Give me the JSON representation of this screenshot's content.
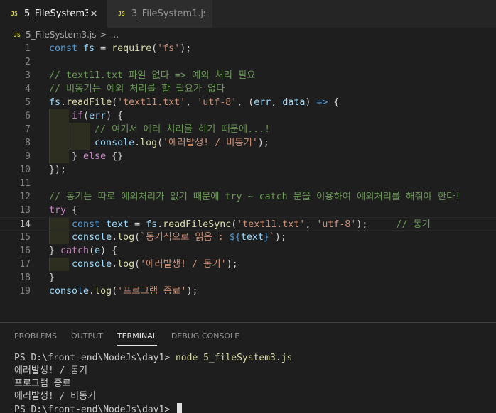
{
  "tabs": [
    {
      "icon": "JS",
      "label": "5_FileSystem3.js",
      "active": true,
      "close": "✕"
    },
    {
      "icon": "JS",
      "label": "3_FileSystem1.js",
      "active": false
    }
  ],
  "breadcrumb": {
    "icon": "JS",
    "file": "5_FileSystem3.js",
    "sep": ">",
    "rest": "..."
  },
  "editor": {
    "current_line": 14,
    "lines": [
      {
        "n": "1",
        "tokens": [
          [
            "k",
            "const "
          ],
          [
            "v",
            "fs "
          ],
          [
            "p",
            "= "
          ],
          [
            "f",
            "require"
          ],
          [
            "p",
            "("
          ],
          [
            "s",
            "'fs'"
          ],
          [
            "p",
            ");"
          ]
        ]
      },
      {
        "n": "2",
        "tokens": []
      },
      {
        "n": "3",
        "tokens": [
          [
            "c",
            "// text11.txt 파일 없다 => 예외 처리 필요"
          ]
        ]
      },
      {
        "n": "4",
        "tokens": [
          [
            "c",
            "// 비동기는 예외 처리를 할 필요가 없다"
          ]
        ]
      },
      {
        "n": "5",
        "tokens": [
          [
            "v",
            "fs"
          ],
          [
            "p",
            "."
          ],
          [
            "f",
            "readFile"
          ],
          [
            "p",
            "("
          ],
          [
            "s",
            "'text11.txt'"
          ],
          [
            "p",
            ", "
          ],
          [
            "s",
            "'utf-8'"
          ],
          [
            "p",
            ", ("
          ],
          [
            "v",
            "err"
          ],
          [
            "p",
            ", "
          ],
          [
            "v",
            "data"
          ],
          [
            "p",
            ") "
          ],
          [
            "k",
            "=>"
          ],
          [
            "p",
            " {"
          ]
        ]
      },
      {
        "n": "6",
        "tokens": [
          [
            "p",
            "    "
          ],
          [
            "cf",
            "if"
          ],
          [
            "p",
            "("
          ],
          [
            "v",
            "err"
          ],
          [
            "p",
            ") {"
          ]
        ]
      },
      {
        "n": "7",
        "tokens": [
          [
            "p",
            "        "
          ],
          [
            "c",
            "// 여기서 에러 처리를 하기 때문에...!"
          ]
        ]
      },
      {
        "n": "8",
        "tokens": [
          [
            "p",
            "        "
          ],
          [
            "v",
            "console"
          ],
          [
            "p",
            "."
          ],
          [
            "f",
            "log"
          ],
          [
            "p",
            "("
          ],
          [
            "s",
            "'에러발생! / 비동기'"
          ],
          [
            "p",
            ");"
          ]
        ]
      },
      {
        "n": "9",
        "tokens": [
          [
            "p",
            "    } "
          ],
          [
            "cf",
            "else"
          ],
          [
            "p",
            " {}"
          ]
        ]
      },
      {
        "n": "10",
        "tokens": [
          [
            "p",
            "});"
          ]
        ]
      },
      {
        "n": "11",
        "tokens": []
      },
      {
        "n": "12",
        "tokens": [
          [
            "c",
            "// 동기는 따로 예외처리가 없기 때문에 try ~ catch 문을 이용하여 예외처리를 해줘야 한다!"
          ]
        ]
      },
      {
        "n": "13",
        "tokens": [
          [
            "cf",
            "try"
          ],
          [
            "p",
            " {"
          ]
        ]
      },
      {
        "n": "14",
        "tokens": [
          [
            "p",
            "    "
          ],
          [
            "k",
            "const "
          ],
          [
            "v",
            "text "
          ],
          [
            "p",
            "= "
          ],
          [
            "v",
            "fs"
          ],
          [
            "p",
            "."
          ],
          [
            "f",
            "readFileSync"
          ],
          [
            "p",
            "("
          ],
          [
            "s",
            "'text11.txt'"
          ],
          [
            "p",
            ", "
          ],
          [
            "s",
            "'utf-8'"
          ],
          [
            "p",
            ");     "
          ],
          [
            "c",
            "// 동기"
          ]
        ]
      },
      {
        "n": "15",
        "tokens": [
          [
            "p",
            "    "
          ],
          [
            "v",
            "console"
          ],
          [
            "p",
            "."
          ],
          [
            "f",
            "log"
          ],
          [
            "p",
            "("
          ],
          [
            "s",
            "`동기식으로 읽음 : "
          ],
          [
            "tpl",
            "${"
          ],
          [
            "v",
            "text"
          ],
          [
            "tpl",
            "}"
          ],
          [
            "s",
            "`"
          ],
          [
            "p",
            ");"
          ]
        ]
      },
      {
        "n": "16",
        "tokens": [
          [
            "p",
            "} "
          ],
          [
            "cf",
            "catch"
          ],
          [
            "p",
            "("
          ],
          [
            "v",
            "e"
          ],
          [
            "p",
            ") {"
          ]
        ]
      },
      {
        "n": "17",
        "tokens": [
          [
            "p",
            "    "
          ],
          [
            "v",
            "console"
          ],
          [
            "p",
            "."
          ],
          [
            "f",
            "log"
          ],
          [
            "p",
            "("
          ],
          [
            "s",
            "'에러발생! / 동기'"
          ],
          [
            "p",
            ");"
          ]
        ]
      },
      {
        "n": "18",
        "tokens": [
          [
            "p",
            "}"
          ]
        ]
      },
      {
        "n": "19",
        "tokens": [
          [
            "v",
            "console"
          ],
          [
            "p",
            "."
          ],
          [
            "f",
            "log"
          ],
          [
            "p",
            "("
          ],
          [
            "s",
            "'프로그램 종료'"
          ],
          [
            "p",
            ");"
          ]
        ]
      }
    ]
  },
  "panel": {
    "tabs": [
      "PROBLEMS",
      "OUTPUT",
      "TERMINAL",
      "DEBUG CONSOLE"
    ],
    "active_tab": "TERMINAL",
    "terminal": {
      "prompt1": "PS D:\\front-end\\NodeJs\\day1> ",
      "command": "node 5_fileSystem3.js",
      "output": [
        "에러발생! / 동기",
        "프로그램 종료",
        "에러발생! / 비동기"
      ],
      "prompt2": "PS D:\\front-end\\NodeJs\\day1> "
    }
  },
  "colors": {
    "background": "#1e1e1e",
    "tabbar": "#252526",
    "keyword": "#569cd6",
    "variable": "#9cdcfe",
    "function": "#dcdcaa",
    "string": "#ce9178",
    "comment": "#6a9955",
    "control": "#c586c0",
    "js_icon": "#cbcb41"
  }
}
